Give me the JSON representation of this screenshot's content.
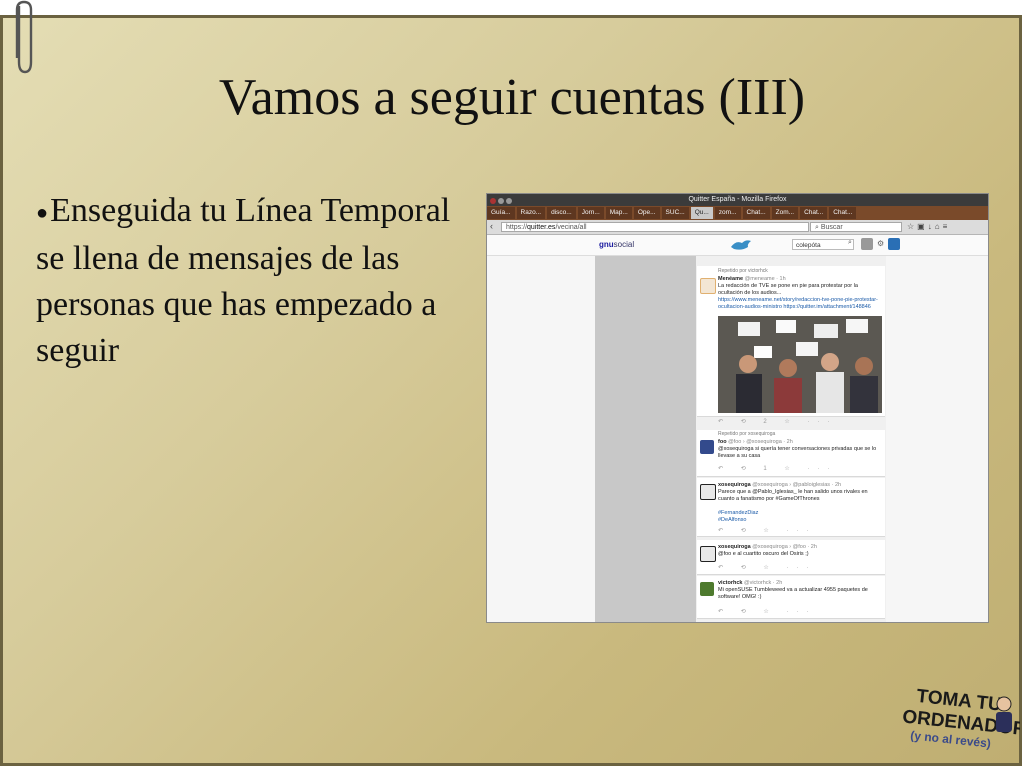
{
  "slide": {
    "title": "Vamos a seguir cuentas (III)",
    "bullet": "Enseguida tu Línea Temporal se llena de mensajes de las personas que has empezado a seguir"
  },
  "browser": {
    "window_title": "Quitter España - Mozilla Firefox",
    "tabs": [
      {
        "label": "Guía..."
      },
      {
        "label": "Razo..."
      },
      {
        "label": "disco..."
      },
      {
        "label": "Jorn..."
      },
      {
        "label": "Map..."
      },
      {
        "label": "Ope..."
      },
      {
        "label": "SUC..."
      },
      {
        "label": "Qu..."
      },
      {
        "label": "zom..."
      },
      {
        "label": "Chat..."
      },
      {
        "label": "Zom..."
      },
      {
        "label": "Chat..."
      },
      {
        "label": "Chat..."
      }
    ],
    "url_prefix": "https://",
    "url_domain": "quitter.es",
    "url_path": "/vecina/all",
    "search_placeholder": "Buscar",
    "site_logo_prefix": "gnu",
    "site_logo_suffix": "social",
    "site_search_value": "colepóta"
  },
  "feed": {
    "posts": [
      {
        "repeated": "Repetido por victorhck",
        "handle": "Menéame",
        "meta": "@meneame · 1h",
        "text": "La redacción de TVE se pone en pie para protestar por la ocultación de los audios...",
        "link": "https://www.meneame.net/story/redaccion-tve-pone-pie-protestar-ocultacion-audios-ministro https://quitter.im/attachment/148846",
        "actions": "↶ ⟲ 2 ☆ ···"
      },
      {
        "repeated": "Repetido por xosequiroga",
        "handle": "foo",
        "meta": "@foo › @xosequiroga · 2h",
        "text": "@xosequiroga si quería tener conversaciones privadas que se lo llevase a su casa",
        "actions": "↶ ⟲ 1 ☆ ···"
      },
      {
        "handle": "xosequiroga",
        "meta": "@xosequiroga › @pabloiglesias · 2h",
        "text": "Parece que a @Pablo_Iglesias_ le han salido unos rivales en cuanto a fanatismo por #GameOfThrones",
        "tags": "#FernandezDiaz",
        "tags2": "#DeAlfonso",
        "actions": "↶ ⟲ ☆ ···"
      },
      {
        "handle": "xosequiroga",
        "meta": "@xosequiroga › @foo · 2h",
        "text": "@foo e al cuartito oscuro del Osiris ;)",
        "actions": "↶ ⟲ ☆ ···"
      },
      {
        "handle": "victorhck",
        "meta": "@victorhck · 2h",
        "text": "Mi openSUSE Tumbleweed va a actualizar 4955 paquetes de software! OMG! :)",
        "actions": "↶ ⟲ ☆ ···"
      }
    ]
  },
  "logo": {
    "line1": "TOMA TU",
    "line2": "ORDENADOR",
    "line3": "(y no al revés)"
  },
  "colors": {
    "panel_border": "#6b6240",
    "panel_light": "#e4ddb4",
    "panel_dark": "#bfae72",
    "tabbar": "#7a4a2a"
  }
}
